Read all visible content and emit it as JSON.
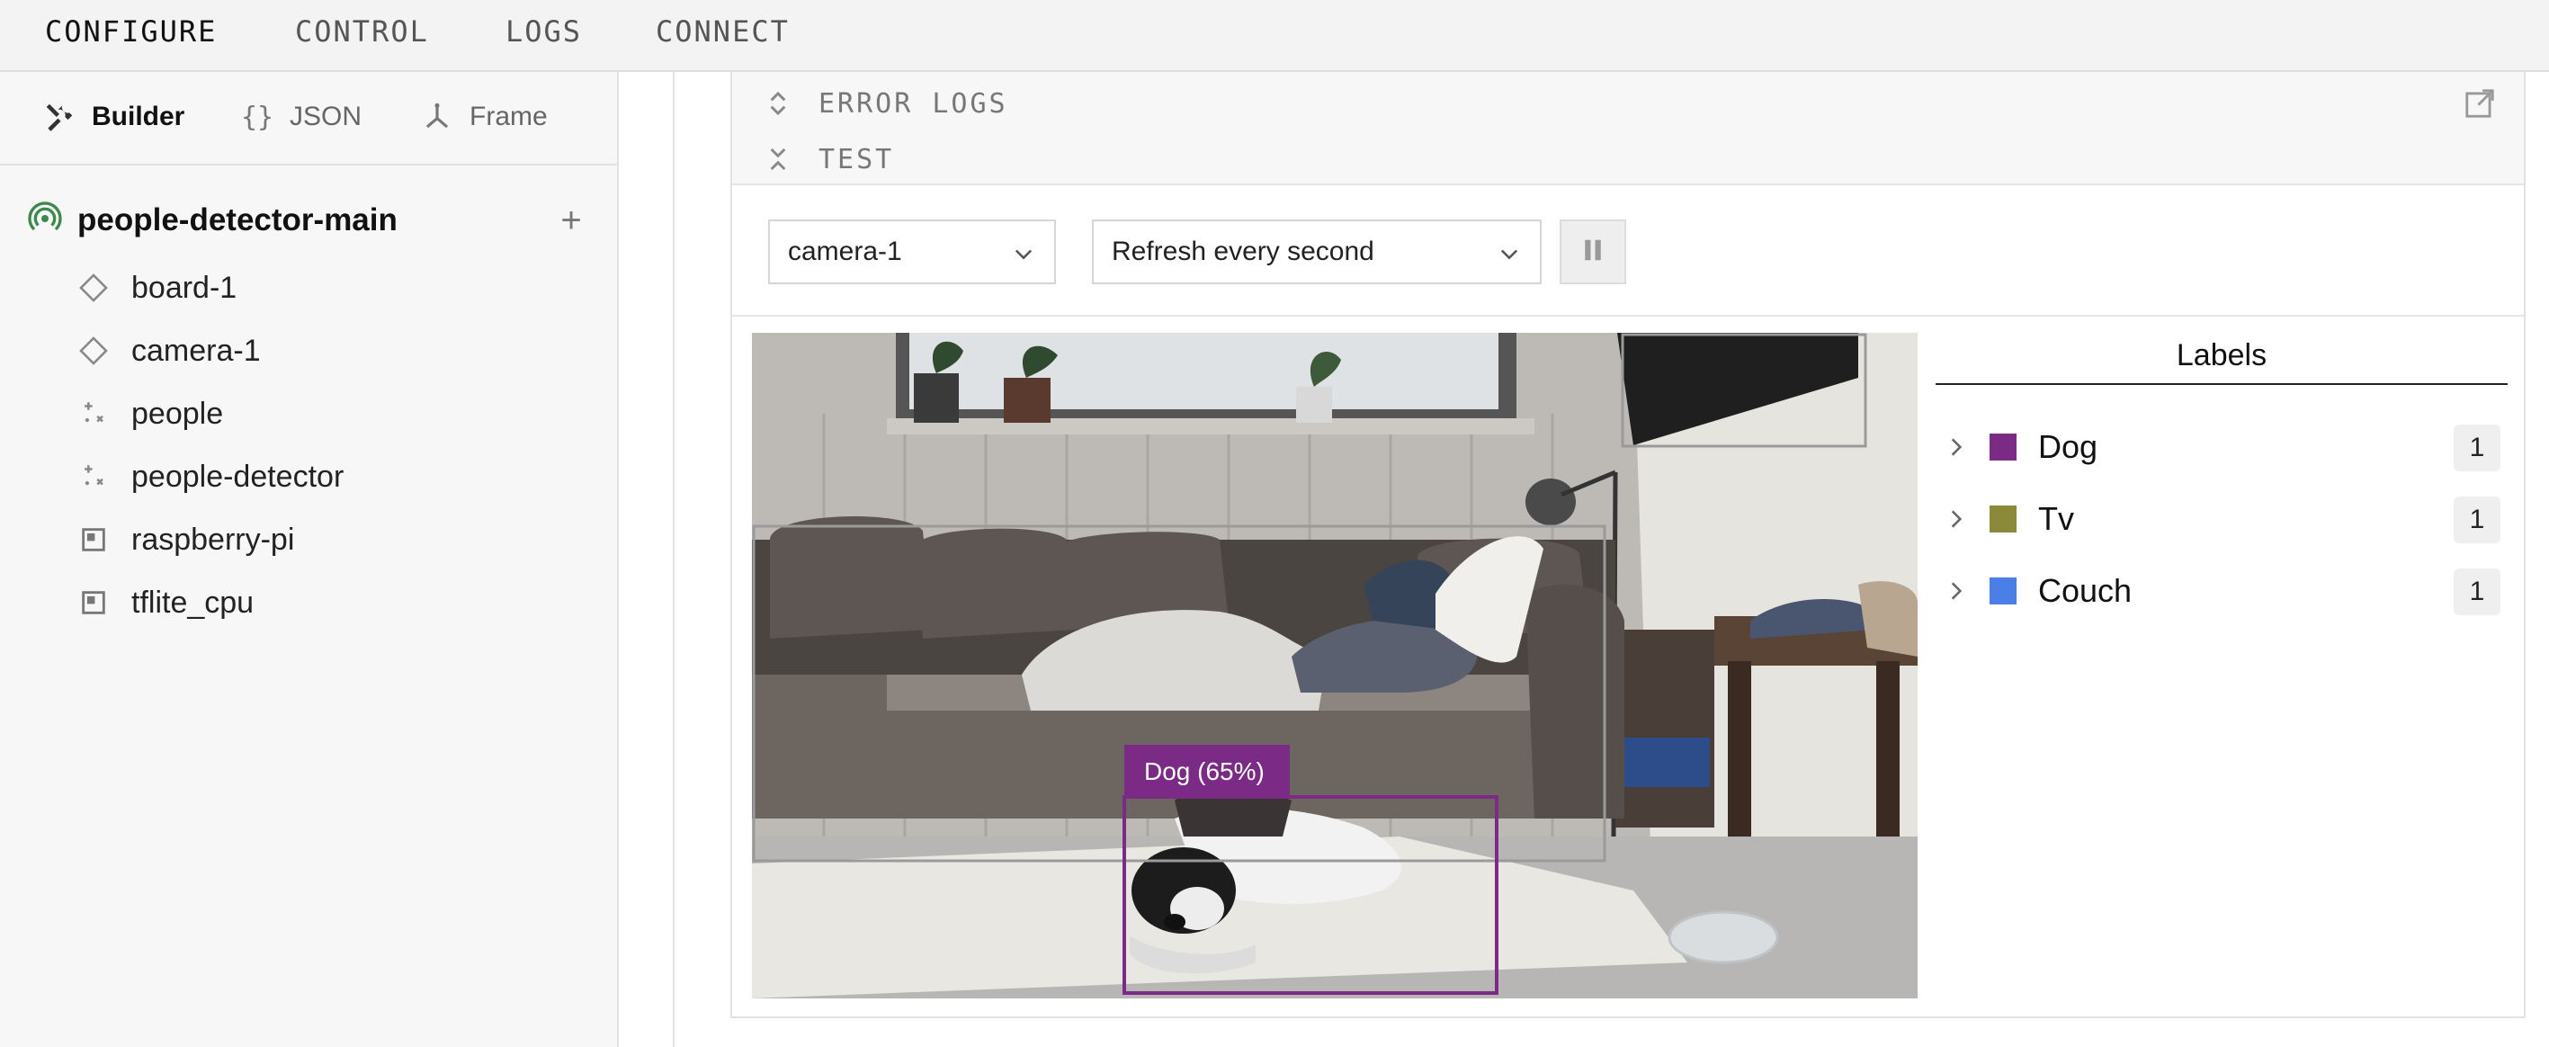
{
  "topnav": {
    "items": [
      "CONFIGURE",
      "CONTROL",
      "LOGS",
      "CONNECT"
    ],
    "active": "CONFIGURE"
  },
  "sidebar": {
    "tabs": [
      {
        "label": "Builder",
        "icon": "tools-icon"
      },
      {
        "label": "JSON",
        "icon": "braces-icon"
      },
      {
        "label": "Frame",
        "icon": "frame-axes-icon"
      }
    ],
    "root": {
      "label": "people-detector-main",
      "icon": "online-status-icon"
    },
    "items": [
      {
        "label": "board-1",
        "icon": "component-diamond-icon"
      },
      {
        "label": "camera-1",
        "icon": "component-diamond-icon"
      },
      {
        "label": "people",
        "icon": "service-sparkle-icon"
      },
      {
        "label": "people-detector",
        "icon": "service-sparkle-icon"
      },
      {
        "label": "raspberry-pi",
        "icon": "module-square-icon"
      },
      {
        "label": "tflite_cpu",
        "icon": "module-square-icon"
      }
    ]
  },
  "main": {
    "sections": [
      {
        "title": "ERROR LOGS"
      },
      {
        "title": "TEST"
      }
    ],
    "camera_select": "camera-1",
    "refresh_select": "Refresh every second",
    "detection_label": "Dog (65%)",
    "labels_title": "Labels",
    "labels": [
      {
        "name": "Dog",
        "color": "#7b2a86",
        "count": "1"
      },
      {
        "name": "Tv",
        "color": "#8a8a3a",
        "count": "1"
      },
      {
        "name": "Couch",
        "color": "#4a7fe8",
        "count": "1"
      }
    ]
  },
  "colors": {
    "accent_purple": "#7b2a86",
    "status_green": "#3a8a4a"
  }
}
